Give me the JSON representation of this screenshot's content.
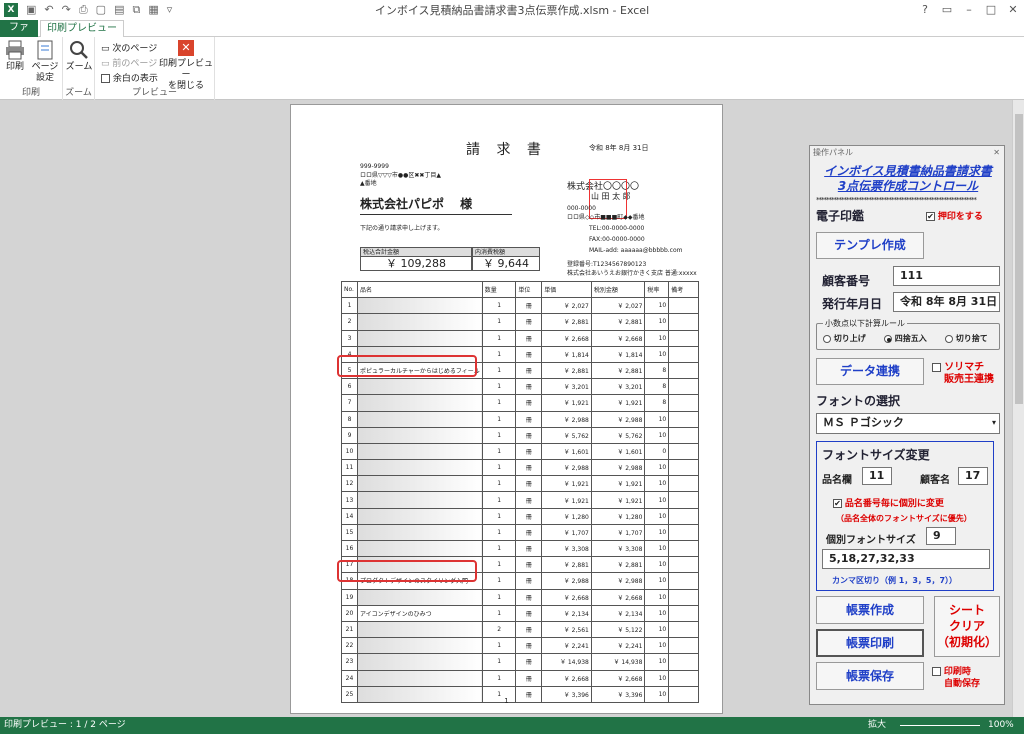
{
  "titlebar": {
    "title": "インボイス見積納品書請求書3点伝票作成.xlsm - Excel",
    "excel_icon": "X",
    "qat_icons": [
      "save-icon",
      "undo-icon",
      "redo-icon",
      "print-preview-icon",
      "new-icon",
      "doc-icon",
      "copy-icon",
      "table-icon",
      "more-icon"
    ],
    "win_buttons": [
      "?",
      "▭",
      "–",
      "□",
      "✕"
    ]
  },
  "tabs": {
    "file": "ファイル",
    "print_preview": "印刷プレビュー"
  },
  "ribbon": {
    "print": "印刷",
    "page_setup_1": "ページ",
    "page_setup_2": "設定",
    "zoom": "ズーム",
    "next_page": "次のページ",
    "prev_page": "前のページ",
    "show_margins": "余白の表示",
    "close_preview_1": "印刷プレビュー",
    "close_preview_2": "を閉じる",
    "group_print": "印刷",
    "group_zoom": "ズーム",
    "group_preview": "プレビュー"
  },
  "status": {
    "page_info": "印刷プレビュー : 1 / 2 ページ",
    "zoom_label": "拡大",
    "zoom_value": "100%"
  },
  "invoice": {
    "title": "請 求 書",
    "date": "令和 8年 8月 31日",
    "postal": "999-9999",
    "address1": "ロロ県▽▽▽市●●区✖✖丁目▲",
    "address2": "▲番地",
    "customer": "株式会社パピポ　 様",
    "note": "下記の通り請求申し上げます。",
    "company": "株式会社〇〇〇〇",
    "person": "山 田 太 郎",
    "seller_postal": "000-0000",
    "seller_address": "ロロ県◇◇市■■■町◆◆番地",
    "tel": "TEL:00-0000-0000",
    "fax": "FAX:00-0000-0000",
    "mail": "MAIL-add: aaaaaa@bbbbb.com",
    "reg_no": "登録番号:T1234567890123",
    "bank": "株式会社あいうえお銀行かきく支店 普通:xxxxx",
    "total_label": "税込合計金額",
    "total_value": "￥ 109,288",
    "tax_label": "内消費税額",
    "tax_value": "￥ 9,644",
    "page_no": "1",
    "columns": [
      "No.",
      "品名",
      "数量",
      "単位",
      "単価",
      "税別金額",
      "税率",
      "備考"
    ],
    "rows": [
      {
        "no": "1",
        "name": "",
        "qty": "1",
        "unit": "冊",
        "price": "￥ 2,027",
        "amount": "￥ 2,027",
        "rate": "10"
      },
      {
        "no": "2",
        "name": "",
        "qty": "1",
        "unit": "冊",
        "price": "￥ 2,881",
        "amount": "￥ 2,881",
        "rate": "10"
      },
      {
        "no": "3",
        "name": "",
        "qty": "1",
        "unit": "冊",
        "price": "￥ 2,668",
        "amount": "￥ 2,668",
        "rate": "10"
      },
      {
        "no": "4",
        "name": "",
        "qty": "1",
        "unit": "冊",
        "price": "￥ 1,814",
        "amount": "￥ 1,814",
        "rate": "10"
      },
      {
        "no": "5",
        "name": "ポピュラーカルチャーからはじめるフィール",
        "qty": "1",
        "unit": "冊",
        "price": "￥ 2,881",
        "amount": "￥ 2,881",
        "rate": "8"
      },
      {
        "no": "6",
        "name": "",
        "qty": "1",
        "unit": "冊",
        "price": "￥ 3,201",
        "amount": "￥ 3,201",
        "rate": "8"
      },
      {
        "no": "7",
        "name": "",
        "qty": "1",
        "unit": "冊",
        "price": "￥ 1,921",
        "amount": "￥ 1,921",
        "rate": "8"
      },
      {
        "no": "8",
        "name": "",
        "qty": "1",
        "unit": "冊",
        "price": "￥ 2,988",
        "amount": "￥ 2,988",
        "rate": "10"
      },
      {
        "no": "9",
        "name": "",
        "qty": "1",
        "unit": "冊",
        "price": "￥ 5,762",
        "amount": "￥ 5,762",
        "rate": "10"
      },
      {
        "no": "10",
        "name": "",
        "qty": "1",
        "unit": "冊",
        "price": "￥ 1,601",
        "amount": "￥ 1,601",
        "rate": "0"
      },
      {
        "no": "11",
        "name": "",
        "qty": "1",
        "unit": "冊",
        "price": "￥ 2,988",
        "amount": "￥ 2,988",
        "rate": "10"
      },
      {
        "no": "12",
        "name": "",
        "qty": "1",
        "unit": "冊",
        "price": "￥ 1,921",
        "amount": "￥ 1,921",
        "rate": "10"
      },
      {
        "no": "13",
        "name": "",
        "qty": "1",
        "unit": "冊",
        "price": "￥ 1,921",
        "amount": "￥ 1,921",
        "rate": "10"
      },
      {
        "no": "14",
        "name": "",
        "qty": "1",
        "unit": "冊",
        "price": "￥ 1,280",
        "amount": "￥ 1,280",
        "rate": "10"
      },
      {
        "no": "15",
        "name": "",
        "qty": "1",
        "unit": "冊",
        "price": "￥ 1,707",
        "amount": "￥ 1,707",
        "rate": "10"
      },
      {
        "no": "16",
        "name": "",
        "qty": "1",
        "unit": "冊",
        "price": "￥ 3,308",
        "amount": "￥ 3,308",
        "rate": "10"
      },
      {
        "no": "17",
        "name": "",
        "qty": "1",
        "unit": "冊",
        "price": "￥ 2,881",
        "amount": "￥ 2,881",
        "rate": "10"
      },
      {
        "no": "18",
        "name": "プロダクトデザインのスタイリング入門",
        "qty": "1",
        "unit": "冊",
        "price": "￥ 2,988",
        "amount": "￥ 2,988",
        "rate": "10"
      },
      {
        "no": "19",
        "name": "",
        "qty": "1",
        "unit": "冊",
        "price": "￥ 2,668",
        "amount": "￥ 2,668",
        "rate": "10"
      },
      {
        "no": "20",
        "name": "アイコンデザインのひみつ",
        "qty": "1",
        "unit": "冊",
        "price": "￥ 2,134",
        "amount": "￥ 2,134",
        "rate": "10"
      },
      {
        "no": "21",
        "name": "",
        "qty": "2",
        "unit": "冊",
        "price": "￥ 2,561",
        "amount": "￥ 5,122",
        "rate": "10"
      },
      {
        "no": "22",
        "name": "",
        "qty": "1",
        "unit": "冊",
        "price": "￥ 2,241",
        "amount": "￥ 2,241",
        "rate": "10"
      },
      {
        "no": "23",
        "name": "",
        "qty": "1",
        "unit": "冊",
        "price": "￥ 14,938",
        "amount": "￥ 14,938",
        "rate": "10"
      },
      {
        "no": "24",
        "name": "",
        "qty": "1",
        "unit": "冊",
        "price": "￥ 2,668",
        "amount": "￥ 2,668",
        "rate": "10"
      },
      {
        "no": "25",
        "name": "",
        "qty": "1",
        "unit": "冊",
        "price": "￥ 3,396",
        "amount": "￥ 3,396",
        "rate": "10"
      }
    ]
  },
  "panel": {
    "header": "操作パネル",
    "close": "✕",
    "title1": "インボイス見積書納品書請求書",
    "title2": "3点伝票作成コントロール",
    "stars": "****************************************************************",
    "stamp_label": "電子印鑑",
    "stamp_check": "押印をする",
    "template_btn": "テンプレ作成",
    "customer_no_label": "顧客番号",
    "customer_no": "111",
    "issue_date_label": "発行年月日",
    "issue_date": "令和 8年 8月 31日",
    "rounding_legend": "小数点以下計算ルール",
    "round_up": "切り上げ",
    "round_half": "四捨五入",
    "round_down": "切り捨て",
    "data_link_btn": "データ連携",
    "sorimachi_1": "ソリマチ",
    "sorimachi_2": "販売王連携",
    "font_select_label": "フォントの選択",
    "font_value": "ＭＳ Ｐゴシック",
    "font_size_title": "フォントサイズ変更",
    "item_col_label": "品名欄",
    "item_col_size": "11",
    "customer_name_label": "顧客名",
    "customer_name_size": "17",
    "per_item_check": "品名番号毎に個別に変更",
    "per_item_note": "（品名全体のフォントサイズに優先）",
    "indiv_size_label": "個別フォントサイズ",
    "indiv_size": "9",
    "indiv_rows": "5,18,27,32,33",
    "comma_note": "カンマ区切り（例 1，3，5，7））",
    "make_btn": "帳票作成",
    "print_btn": "帳票印刷",
    "save_btn": "帳票保存",
    "clear_1": "シート",
    "clear_2": "クリア",
    "clear_3": "（初期化）",
    "autosave_1": "印刷時",
    "autosave_2": "自動保存"
  }
}
